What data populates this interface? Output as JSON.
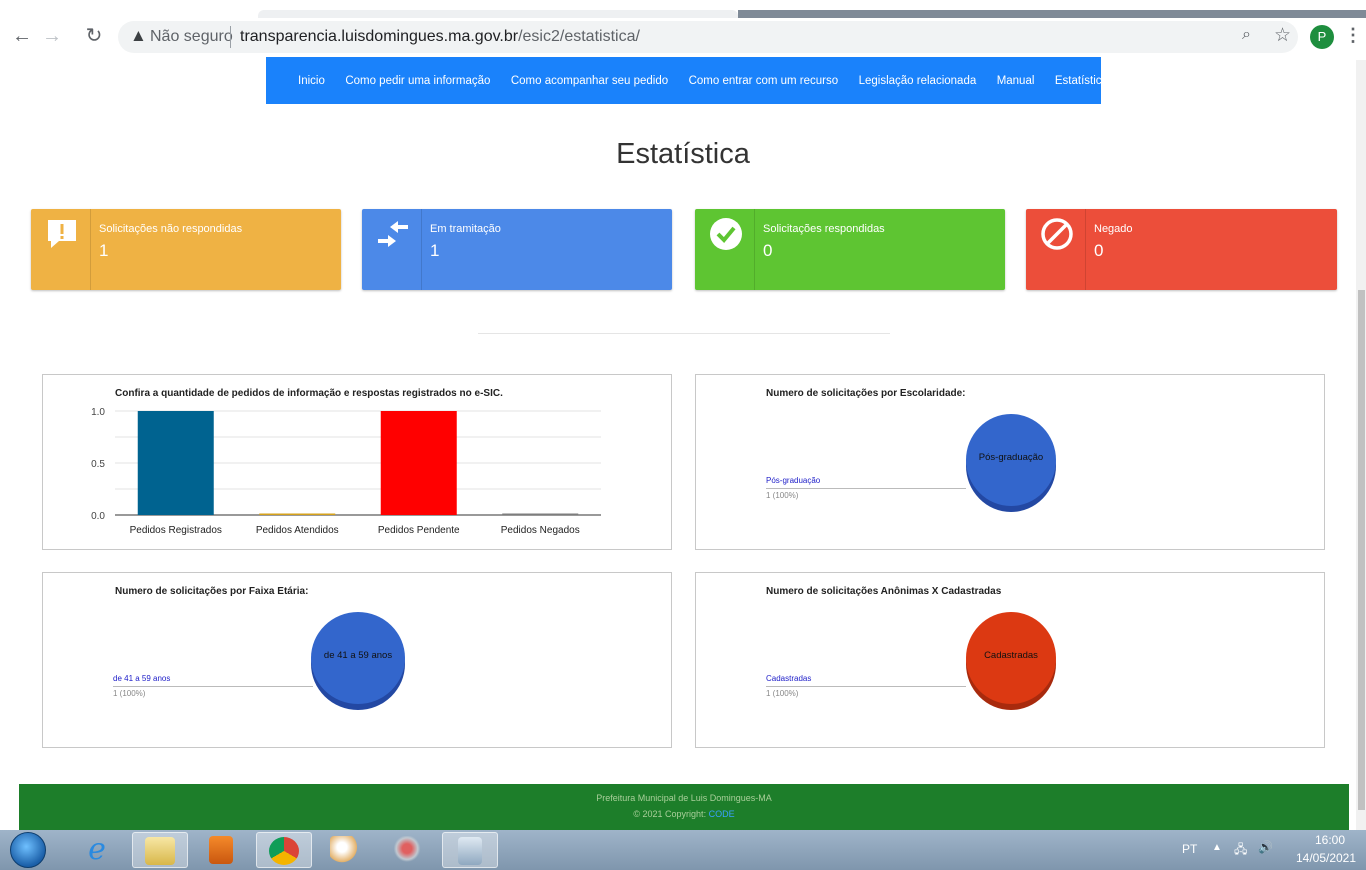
{
  "browser": {
    "not_secure": "Não seguro",
    "url_host": "transparencia.luisdomingues.ma.gov.br",
    "url_path": "/esic2/estatistica/",
    "profile_initial": "P"
  },
  "nav": {
    "items": [
      "Inicio",
      "Como pedir uma informação",
      "Como acompanhar seu pedido",
      "Como entrar com um recurso",
      "Legislação relacionada",
      "Manual",
      "Estatística"
    ]
  },
  "page": {
    "title": "Estatística"
  },
  "cards": [
    {
      "label": "Solicitações não respondidas",
      "value": "1",
      "color": "#efb244",
      "icon": "alert-message-icon"
    },
    {
      "label": "Em tramitação",
      "value": "1",
      "color": "#4c89e8",
      "icon": "transfer-arrows-icon"
    },
    {
      "label": "Solicitações respondidas",
      "value": "0",
      "color": "#5ec532",
      "icon": "check-circle-icon"
    },
    {
      "label": "Negado",
      "value": "0",
      "color": "#ec4e3a",
      "icon": "ban-icon"
    }
  ],
  "chart_data": [
    {
      "type": "bar",
      "title": "Confira a quantidade de pedidos de informação e respostas registrados no e-SIC.",
      "categories": [
        "Pedidos Registrados",
        "Pedidos Atendidos",
        "Pedidos Pendente",
        "Pedidos Negados"
      ],
      "values": [
        1,
        0,
        1,
        0
      ],
      "colors": [
        "#006390",
        "#d6a21b",
        "#ff0000",
        "#7d7d7d"
      ],
      "ylim": [
        0,
        1
      ],
      "yticks": [
        "1.0",
        "0.5",
        "0.0"
      ],
      "grid": true
    },
    {
      "type": "pie",
      "title": "Numero de solicitações por Escolaridade:",
      "categories": [
        "Pós-graduação"
      ],
      "values": [
        1
      ],
      "percent_labels": [
        "1 (100%)"
      ],
      "colors": [
        "#3366cc"
      ]
    },
    {
      "type": "pie",
      "title": "Numero de solicitações por Faixa Etária:",
      "categories": [
        "de 41 a 59 anos"
      ],
      "values": [
        1
      ],
      "percent_labels": [
        "1 (100%)"
      ],
      "colors": [
        "#3366cc"
      ]
    },
    {
      "type": "pie",
      "title": "Numero de solicitações Anônimas X Cadastradas",
      "categories": [
        "Cadastradas"
      ],
      "values": [
        1
      ],
      "percent_labels": [
        "1 (100%)"
      ],
      "colors": [
        "#dc3912"
      ]
    }
  ],
  "footer": {
    "org": "Prefeitura Municipal de Luis Domingues-MA",
    "copy_prefix": "© 2021 Copyright:",
    "copy_link": "CODE"
  },
  "taskbar": {
    "lang": "PT",
    "time": "16:00",
    "date": "14/05/2021"
  }
}
